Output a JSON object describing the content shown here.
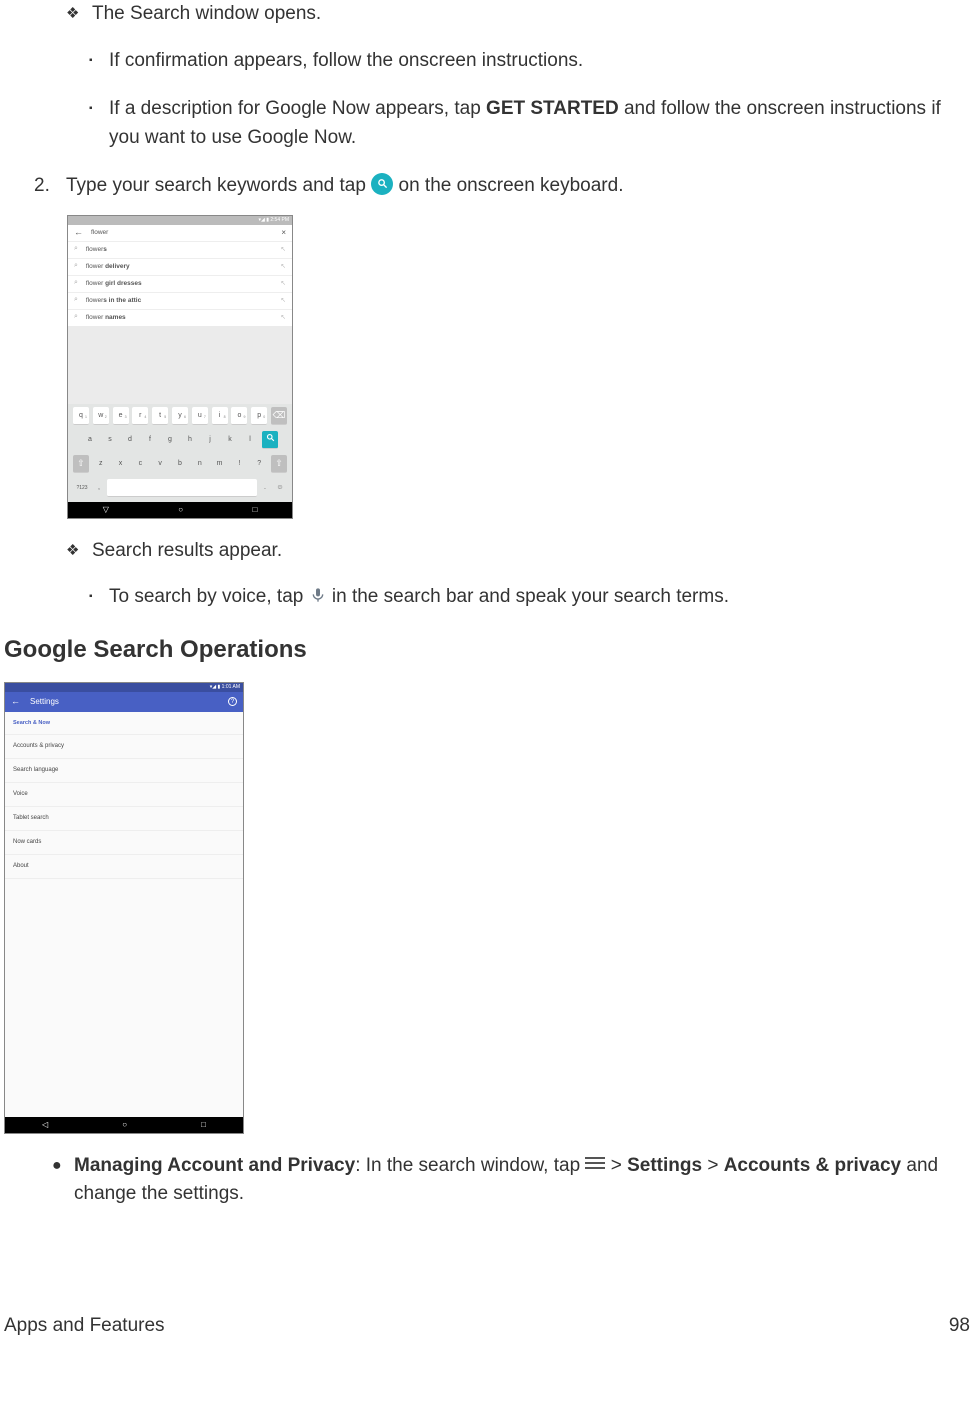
{
  "list1": {
    "diamond1": "The Search window opens.",
    "square1": "If confirmation appears, follow the onscreen instructions.",
    "square2_pre": "If a description for Google Now appears, tap ",
    "square2_bold": "GET STARTED",
    "square2_post": " and follow the onscreen instructions if you want to use Google Now.",
    "step_num": "2.",
    "step2_pre": "Type your search keywords and tap ",
    "step2_post": " on the onscreen keyboard.",
    "diamond2": "Search results appear.",
    "square3_pre": "To search by voice, tap ",
    "square3_post": " in the search bar and speak your search terms."
  },
  "section_heading": "Google Search Operations",
  "ops": {
    "bold1": "Managing Account and Privacy",
    "text1": ": In the search window, tap ",
    "sep1": " > ",
    "bold2": "Settings",
    "sep2": " > ",
    "bold3": "Accounts & privacy",
    "text2": " and change the settings."
  },
  "shot1": {
    "status_time": "▾◢ ▮ 2:54 PM",
    "query": "flower",
    "suggestions": [
      {
        "base": "flower",
        "ext": "s"
      },
      {
        "base": "flower ",
        "ext": "delivery"
      },
      {
        "base": "flower ",
        "ext": "girl dresses"
      },
      {
        "base": "flower",
        "ext": "s in the attic"
      },
      {
        "base": "flower ",
        "ext": "names"
      }
    ],
    "kb_row1": [
      "q",
      "w",
      "e",
      "r",
      "t",
      "y",
      "u",
      "i",
      "o",
      "p"
    ],
    "kb_sup": [
      "1",
      "2",
      "3",
      "4",
      "5",
      "6",
      "7",
      "8",
      "9",
      "0"
    ],
    "kb_row2": [
      "a",
      "s",
      "d",
      "f",
      "g",
      "h",
      "j",
      "k",
      "l"
    ],
    "kb_row3": [
      "z",
      "x",
      "c",
      "v",
      "b",
      "n",
      "m",
      "!",
      "?"
    ],
    "kb_sym": "?123",
    "kb_comma": ",",
    "kb_period": ".",
    "nav": {
      "back": "▽",
      "home": "○",
      "recent": "□"
    }
  },
  "shot2": {
    "status_time": "▾◢ ▮ 1:01 AM",
    "title": "Settings",
    "header": "Search & Now",
    "items": [
      "Accounts & privacy",
      "Search language",
      "Voice",
      "Tablet search",
      "Now cards",
      "About"
    ],
    "nav": {
      "back": "◁",
      "home": "○",
      "recent": "□"
    }
  },
  "footer": {
    "left": "Apps and Features",
    "right": "98"
  }
}
